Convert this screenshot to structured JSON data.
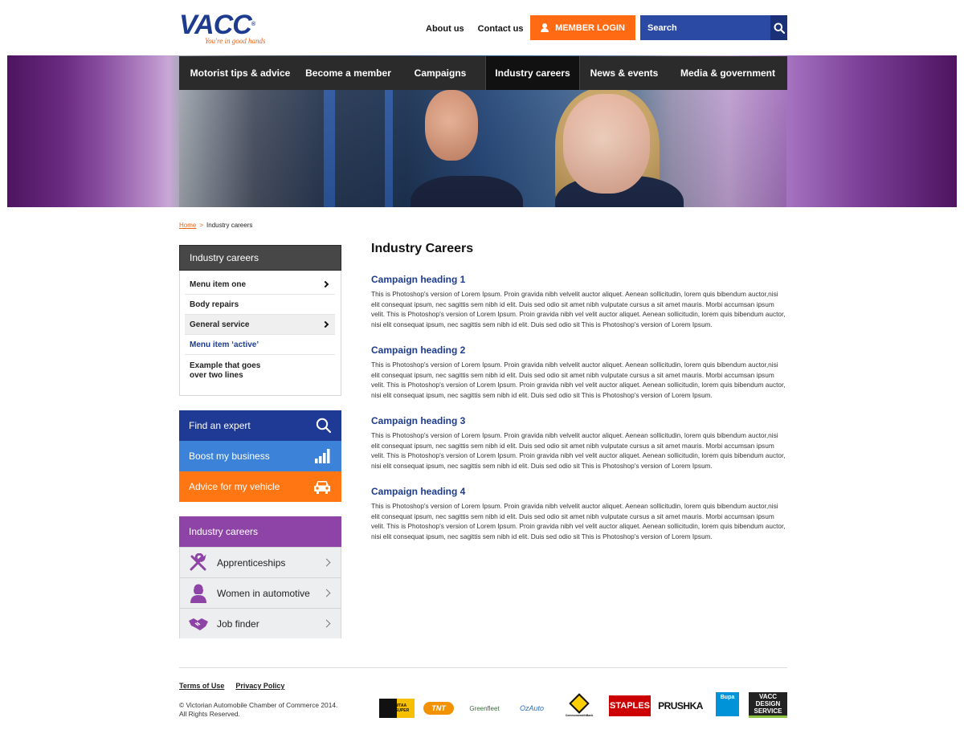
{
  "brand": {
    "name": "VACC",
    "tagline": "You're in good hands",
    "primary": "#1d3c8f",
    "accent": "#ff6a13",
    "purple": "#8e44a6"
  },
  "header": {
    "links": [
      "About us",
      "Contact us"
    ],
    "member_login": "MEMBER LOGIN",
    "search_placeholder": "Search"
  },
  "nav": {
    "items": [
      {
        "label": "Motorist tips & advice",
        "active": false
      },
      {
        "label": "Become a member",
        "active": false
      },
      {
        "label": "Campaigns",
        "active": false
      },
      {
        "label": "Industry careers",
        "active": true
      },
      {
        "label": "News & events",
        "active": false
      },
      {
        "label": "Media & government",
        "active": false
      }
    ]
  },
  "breadcrumb": {
    "home": "Home",
    "separator": ">",
    "current": "Industry careers"
  },
  "side_menu": {
    "title": "Industry careers",
    "items": [
      {
        "label": "Menu item one",
        "chevron": true
      },
      {
        "label": "Body repairs",
        "chevron": false
      },
      {
        "label": "General service",
        "chevron": true
      },
      {
        "label": "Menu item ‘active’",
        "chevron": false
      },
      {
        "label": "Example that goes over two lines",
        "chevron": false
      }
    ]
  },
  "quick_links": [
    {
      "label": "Find an expert",
      "icon": "search-icon"
    },
    {
      "label": "Boost my business",
      "icon": "bar-chart-icon"
    },
    {
      "label": "Advice for my vehicle",
      "icon": "car-icon"
    }
  ],
  "careers_box": {
    "title": "Industry careers",
    "items": [
      {
        "label": "Apprenticeships",
        "icon": "tools-icon"
      },
      {
        "label": "Women in automotive",
        "icon": "woman-icon"
      },
      {
        "label": "Job finder",
        "icon": "handshake-icon"
      }
    ]
  },
  "main": {
    "title": "Industry Careers",
    "campaigns": [
      {
        "heading": "Campaign heading 1",
        "body": "This is Photoshop's version of Lorem Ipsum. Proin gravida nibh velvelit auctor aliquet. Aenean sollicitudin, lorem quis bibendum auctor,nisi elit consequat ipsum, nec sagittis sem nibh id elit. Duis sed odio sit amet nibh vulputate cursus a sit amet mauris. Morbi accumsan ipsum velit. This is Photoshop's version  of Lorem Ipsum. Proin gravida nibh vel velit auctor aliquet. Aenean sollicitudin, lorem quis bibendum auctor, nisi elit consequat ipsum, nec sagittis sem nibh id elit. Duis sed odio sit This is Photoshop's version  of Lorem Ipsum."
      },
      {
        "heading": "Campaign heading 2",
        "body": "This is Photoshop's version of Lorem Ipsum. Proin gravida nibh velvelit auctor aliquet. Aenean sollicitudin, lorem quis bibendum auctor,nisi elit consequat ipsum, nec sagittis sem nibh id elit. Duis sed odio sit amet nibh vulputate cursus a sit amet mauris. Morbi accumsan ipsum velit. This is Photoshop's version  of Lorem Ipsum. Proin gravida nibh vel velit auctor aliquet. Aenean sollicitudin, lorem quis bibendum auctor, nisi elit consequat ipsum, nec sagittis sem nibh id elit. Duis sed odio sit This is Photoshop's version  of Lorem Ipsum."
      },
      {
        "heading": "Campaign heading 3",
        "body": "This is Photoshop's version of Lorem Ipsum. Proin gravida nibh velvelit auctor aliquet. Aenean sollicitudin, lorem quis bibendum auctor,nisi elit consequat ipsum, nec sagittis sem nibh id elit. Duis sed odio sit amet nibh vulputate cursus a sit amet mauris. Morbi accumsan ipsum velit. This is Photoshop's version  of Lorem Ipsum. Proin gravida nibh vel velit auctor aliquet. Aenean sollicitudin, lorem quis bibendum auctor, nisi elit consequat ipsum, nec sagittis sem nibh id elit. Duis sed odio sit This is Photoshop's version  of Lorem Ipsum."
      },
      {
        "heading": "Campaign heading 4",
        "body": "This is Photoshop's version of Lorem Ipsum. Proin gravida nibh velvelit auctor aliquet. Aenean sollicitudin, lorem quis bibendum auctor,nisi elit consequat ipsum, nec sagittis sem nibh id elit. Duis sed odio sit amet nibh vulputate cursus a sit amet mauris. Morbi accumsan ipsum velit. This is Photoshop's version  of Lorem Ipsum. Proin gravida nibh vel velit auctor aliquet. Aenean sollicitudin, lorem quis bibendum auctor, nisi elit consequat ipsum, nec sagittis sem nibh id elit. Duis sed odio sit This is Photoshop's version  of Lorem Ipsum."
      }
    ]
  },
  "footer": {
    "links": [
      "Terms of Use",
      "Privacy Policy"
    ],
    "copyright_line1": "© Victorian Automobile Chamber of Commerce  2014.",
    "copyright_line2": "All Rights Reserved.",
    "sponsors": [
      {
        "name": "MTAA SUPER",
        "icon": "mtaa-super-logo"
      },
      {
        "name": "TNT",
        "icon": "tnt-logo"
      },
      {
        "name": "Greenfleet",
        "icon": "greenfleet-logo"
      },
      {
        "name": "OzAuto",
        "icon": "ozauto-logo"
      },
      {
        "name": "CommonwealthBank",
        "icon": "commonwealth-bank-logo"
      },
      {
        "name": "STAPLES",
        "icon": "staples-logo"
      },
      {
        "name": "PRUSHKA",
        "icon": "prushka-logo"
      },
      {
        "name": "Bupa",
        "icon": "bupa-logo"
      },
      {
        "name": "VACC DESIGN SERVICE",
        "icon": "vacc-design-service-logo"
      }
    ]
  }
}
